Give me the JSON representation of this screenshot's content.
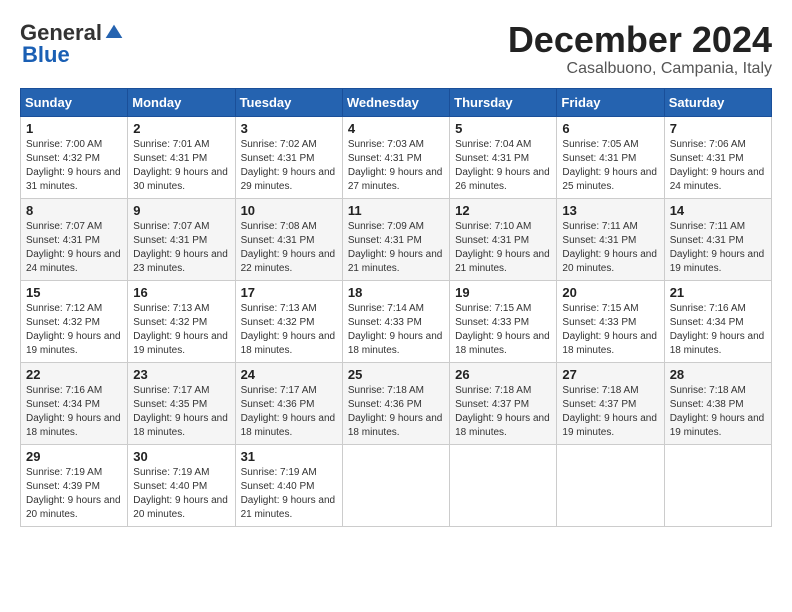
{
  "header": {
    "logo_general": "General",
    "logo_blue": "Blue",
    "month_title": "December 2024",
    "location": "Casalbuono, Campania, Italy"
  },
  "calendar": {
    "days_of_week": [
      "Sunday",
      "Monday",
      "Tuesday",
      "Wednesday",
      "Thursday",
      "Friday",
      "Saturday"
    ],
    "weeks": [
      [
        null,
        {
          "day": 2,
          "sunrise": "7:01 AM",
          "sunset": "4:31 PM",
          "daylight": "9 hours and 30 minutes."
        },
        {
          "day": 3,
          "sunrise": "7:02 AM",
          "sunset": "4:31 PM",
          "daylight": "9 hours and 29 minutes."
        },
        {
          "day": 4,
          "sunrise": "7:03 AM",
          "sunset": "4:31 PM",
          "daylight": "9 hours and 27 minutes."
        },
        {
          "day": 5,
          "sunrise": "7:04 AM",
          "sunset": "4:31 PM",
          "daylight": "9 hours and 26 minutes."
        },
        {
          "day": 6,
          "sunrise": "7:05 AM",
          "sunset": "4:31 PM",
          "daylight": "9 hours and 25 minutes."
        },
        {
          "day": 7,
          "sunrise": "7:06 AM",
          "sunset": "4:31 PM",
          "daylight": "9 hours and 24 minutes."
        }
      ],
      [
        {
          "day": 1,
          "sunrise": "7:00 AM",
          "sunset": "4:32 PM",
          "daylight": "9 hours and 31 minutes."
        },
        null,
        null,
        null,
        null,
        null,
        null
      ],
      [
        {
          "day": 8,
          "sunrise": "7:07 AM",
          "sunset": "4:31 PM",
          "daylight": "9 hours and 24 minutes."
        },
        {
          "day": 9,
          "sunrise": "7:07 AM",
          "sunset": "4:31 PM",
          "daylight": "9 hours and 23 minutes."
        },
        {
          "day": 10,
          "sunrise": "7:08 AM",
          "sunset": "4:31 PM",
          "daylight": "9 hours and 22 minutes."
        },
        {
          "day": 11,
          "sunrise": "7:09 AM",
          "sunset": "4:31 PM",
          "daylight": "9 hours and 21 minutes."
        },
        {
          "day": 12,
          "sunrise": "7:10 AM",
          "sunset": "4:31 PM",
          "daylight": "9 hours and 21 minutes."
        },
        {
          "day": 13,
          "sunrise": "7:11 AM",
          "sunset": "4:31 PM",
          "daylight": "9 hours and 20 minutes."
        },
        {
          "day": 14,
          "sunrise": "7:11 AM",
          "sunset": "4:31 PM",
          "daylight": "9 hours and 19 minutes."
        }
      ],
      [
        {
          "day": 15,
          "sunrise": "7:12 AM",
          "sunset": "4:32 PM",
          "daylight": "9 hours and 19 minutes."
        },
        {
          "day": 16,
          "sunrise": "7:13 AM",
          "sunset": "4:32 PM",
          "daylight": "9 hours and 19 minutes."
        },
        {
          "day": 17,
          "sunrise": "7:13 AM",
          "sunset": "4:32 PM",
          "daylight": "9 hours and 18 minutes."
        },
        {
          "day": 18,
          "sunrise": "7:14 AM",
          "sunset": "4:33 PM",
          "daylight": "9 hours and 18 minutes."
        },
        {
          "day": 19,
          "sunrise": "7:15 AM",
          "sunset": "4:33 PM",
          "daylight": "9 hours and 18 minutes."
        },
        {
          "day": 20,
          "sunrise": "7:15 AM",
          "sunset": "4:33 PM",
          "daylight": "9 hours and 18 minutes."
        },
        {
          "day": 21,
          "sunrise": "7:16 AM",
          "sunset": "4:34 PM",
          "daylight": "9 hours and 18 minutes."
        }
      ],
      [
        {
          "day": 22,
          "sunrise": "7:16 AM",
          "sunset": "4:34 PM",
          "daylight": "9 hours and 18 minutes."
        },
        {
          "day": 23,
          "sunrise": "7:17 AM",
          "sunset": "4:35 PM",
          "daylight": "9 hours and 18 minutes."
        },
        {
          "day": 24,
          "sunrise": "7:17 AM",
          "sunset": "4:36 PM",
          "daylight": "9 hours and 18 minutes."
        },
        {
          "day": 25,
          "sunrise": "7:18 AM",
          "sunset": "4:36 PM",
          "daylight": "9 hours and 18 minutes."
        },
        {
          "day": 26,
          "sunrise": "7:18 AM",
          "sunset": "4:37 PM",
          "daylight": "9 hours and 18 minutes."
        },
        {
          "day": 27,
          "sunrise": "7:18 AM",
          "sunset": "4:37 PM",
          "daylight": "9 hours and 19 minutes."
        },
        {
          "day": 28,
          "sunrise": "7:18 AM",
          "sunset": "4:38 PM",
          "daylight": "9 hours and 19 minutes."
        }
      ],
      [
        {
          "day": 29,
          "sunrise": "7:19 AM",
          "sunset": "4:39 PM",
          "daylight": "9 hours and 20 minutes."
        },
        {
          "day": 30,
          "sunrise": "7:19 AM",
          "sunset": "4:40 PM",
          "daylight": "9 hours and 20 minutes."
        },
        {
          "day": 31,
          "sunrise": "7:19 AM",
          "sunset": "4:40 PM",
          "daylight": "9 hours and 21 minutes."
        },
        null,
        null,
        null,
        null
      ]
    ]
  }
}
